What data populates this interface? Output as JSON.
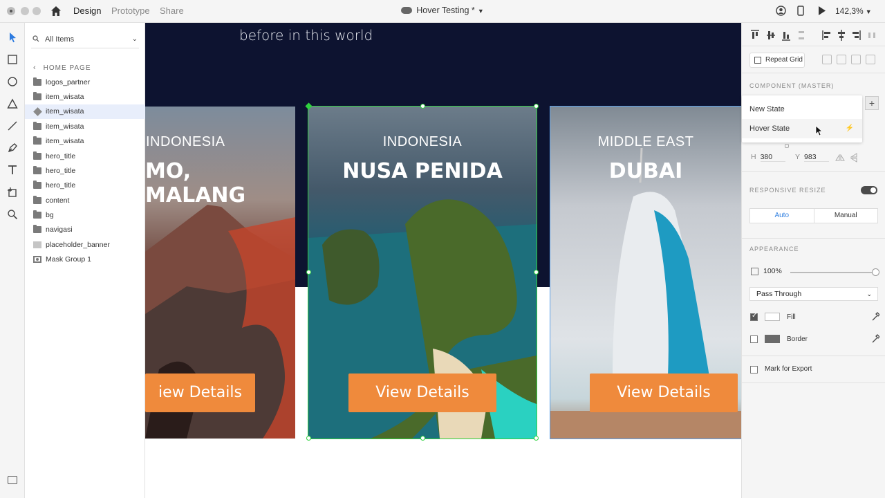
{
  "topbar": {
    "tabs": [
      {
        "label": "Design",
        "active": true
      },
      {
        "label": "Prototype",
        "active": false
      },
      {
        "label": "Share",
        "active": false
      }
    ],
    "doc_title": "Hover Testing *",
    "zoom": "142,3%"
  },
  "layers": {
    "filter_label": "All Items",
    "back_label": "HOME PAGE",
    "items": [
      {
        "label": "logos_partner",
        "icon": "folder-icon"
      },
      {
        "label": "item_wisata",
        "icon": "folder-icon"
      },
      {
        "label": "item_wisata",
        "icon": "component-icon",
        "selected": true
      },
      {
        "label": "item_wisata",
        "icon": "folder-icon"
      },
      {
        "label": "item_wisata",
        "icon": "folder-icon"
      },
      {
        "label": "hero_title",
        "icon": "folder-icon"
      },
      {
        "label": "hero_title",
        "icon": "folder-icon"
      },
      {
        "label": "hero_title",
        "icon": "folder-icon"
      },
      {
        "label": "content",
        "icon": "folder-icon"
      },
      {
        "label": "bg",
        "icon": "folder-icon"
      },
      {
        "label": "navigasi",
        "icon": "folder-icon"
      },
      {
        "label": "placeholder_banner",
        "icon": "rectangle-icon"
      },
      {
        "label": "Mask Group 1",
        "icon": "mask-icon"
      }
    ]
  },
  "canvas": {
    "hero_text": "before in this world",
    "cards": [
      {
        "region": "INDONESIA",
        "city": "MO, MALANG",
        "button": "iew Details"
      },
      {
        "region": "INDONESIA",
        "city": "NUSA PENIDA",
        "button": "View Details"
      },
      {
        "region": "MIDDLE EAST",
        "city": "DUBAI",
        "button": "View Details"
      }
    ],
    "colors": {
      "hero_bg": "#0d1330",
      "button": "#ef8a3c",
      "selection": "#2fd13f"
    }
  },
  "props": {
    "repeat_grid": "Repeat Grid",
    "component_label": "COMPONENT (MASTER)",
    "states": [
      "New State",
      "Hover State"
    ],
    "h_label": "H",
    "h_value": "380",
    "y_label": "Y",
    "y_value": "983",
    "responsive_label": "RESPONSIVE RESIZE",
    "resize_modes": [
      "Auto",
      "Manual"
    ],
    "appearance_label": "APPEARANCE",
    "opacity": "100%",
    "blend_mode": "Pass Through",
    "fill_label": "Fill",
    "border_label": "Border",
    "export_label": "Mark for Export"
  }
}
